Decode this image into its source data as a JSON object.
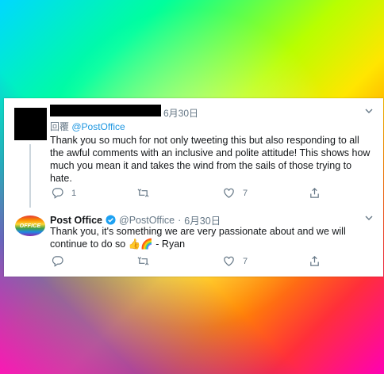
{
  "tweet1": {
    "date": "6月30日",
    "reply_prefix": "回覆",
    "reply_to": "@PostOffice",
    "text": "Thank you so much for not only tweeting this but also responding to all the awful comments with an inclusive and polite attitude! This shows how much you mean it and takes the wind from the sails of those trying to hate.",
    "replies": "1",
    "retweets": "",
    "likes": "7"
  },
  "tweet2": {
    "avatar_text": "OFFICE",
    "name": "Post Office",
    "handle": "@PostOffice",
    "separator": "·",
    "date": "6月30日",
    "text": "Thank you, it's something we are very passionate about and we will continue to do so 👍🌈 - Ryan",
    "replies": "",
    "retweets": "",
    "likes": "7"
  },
  "colors": {
    "link": "#1b95e0",
    "muted": "#657786",
    "text": "#14171a",
    "verified": "#1da1f2"
  },
  "icons": [
    "chevron-down-icon",
    "reply-icon",
    "retweet-icon",
    "like-icon",
    "share-icon",
    "verified-badge-icon"
  ]
}
